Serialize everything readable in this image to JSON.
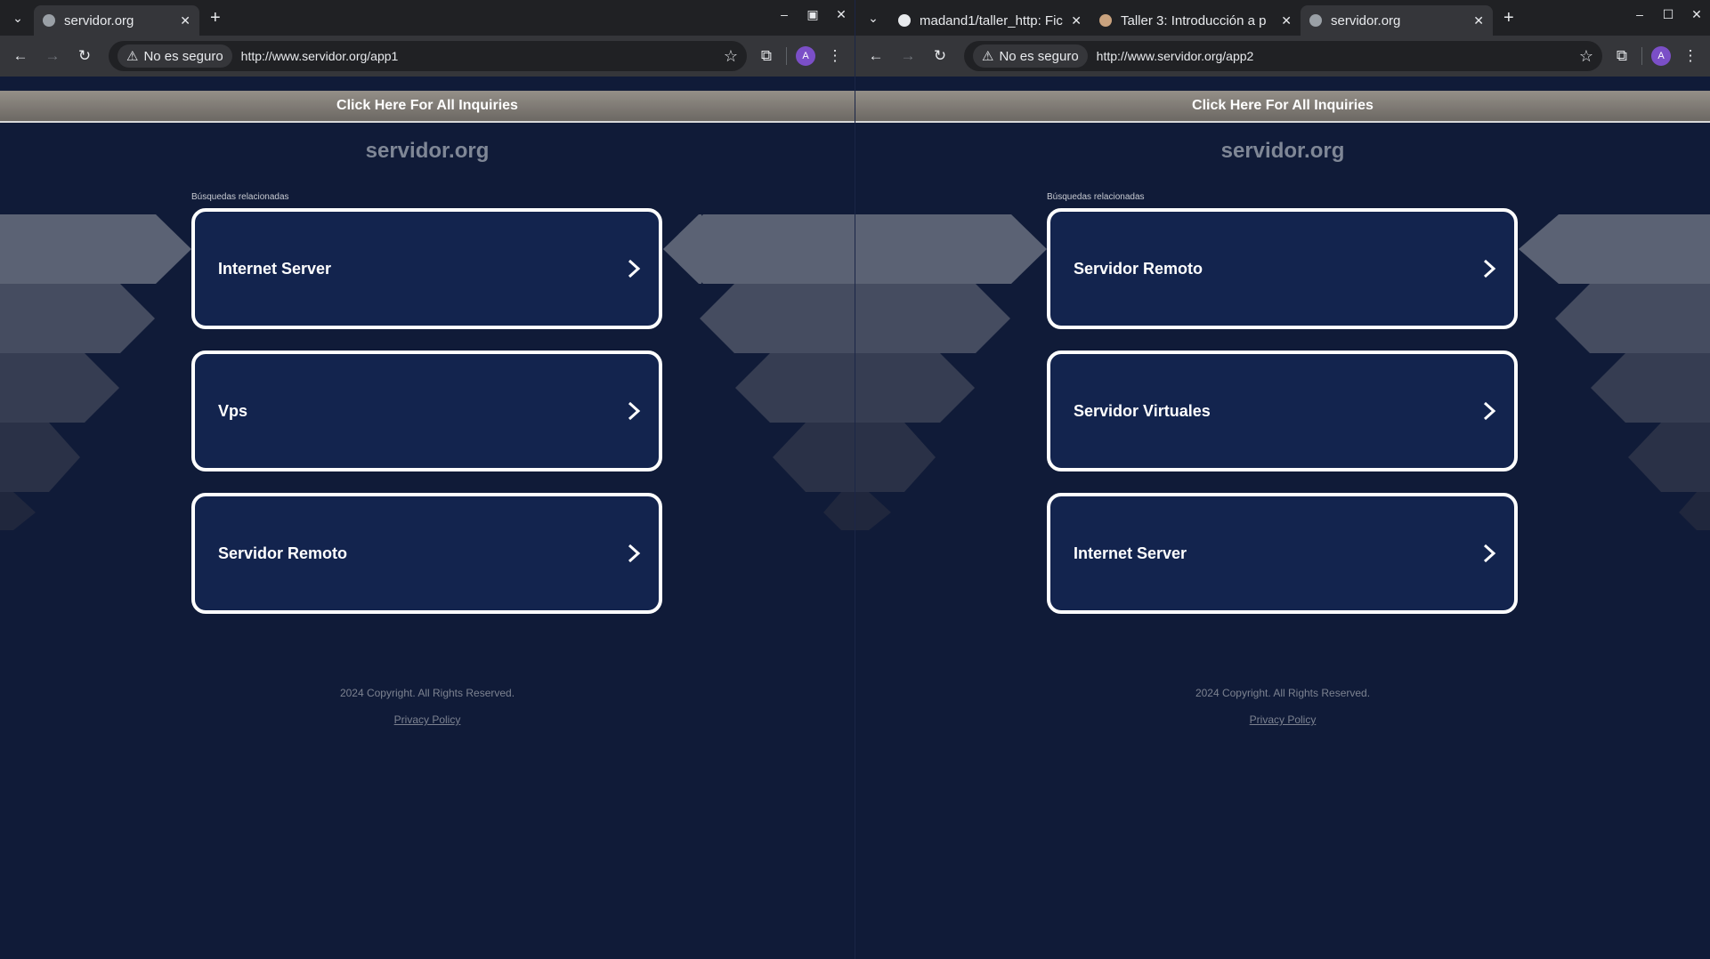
{
  "left_window": {
    "tabs": [
      {
        "title": "servidor.org",
        "active": true
      }
    ],
    "security_label": "No es seguro",
    "url": "http://www.servidor.org/app1",
    "avatar_letter": "A",
    "page": {
      "inquiry_banner": "Click Here For All Inquiries",
      "domain": "servidor.org",
      "related_label": "Búsquedas relacionadas",
      "links": [
        "Internet Server",
        "Vps",
        "Servidor Remoto"
      ],
      "copyright": "2024 Copyright. All Rights Reserved.",
      "privacy": "Privacy Policy"
    }
  },
  "right_window": {
    "tabs": [
      {
        "title": "madand1/taller_http: Fic",
        "active": false
      },
      {
        "title": "Taller 3: Introducción a p",
        "active": false
      },
      {
        "title": "servidor.org",
        "active": true
      }
    ],
    "security_label": "No es seguro",
    "url": "http://www.servidor.org/app2",
    "avatar_letter": "A",
    "page": {
      "inquiry_banner": "Click Here For All Inquiries",
      "domain": "servidor.org",
      "related_label": "Búsquedas relacionadas",
      "links": [
        "Servidor Remoto",
        "Servidor Virtuales",
        "Internet Server"
      ],
      "copyright": "2024 Copyright. All Rights Reserved.",
      "privacy": "Privacy Policy"
    }
  },
  "colors": {
    "page_bg": "#101b38",
    "card_bg": "#13244e",
    "banner_bg": "#8a857e",
    "chrome_bg": "#202124",
    "toolbar_bg": "#35363a"
  }
}
